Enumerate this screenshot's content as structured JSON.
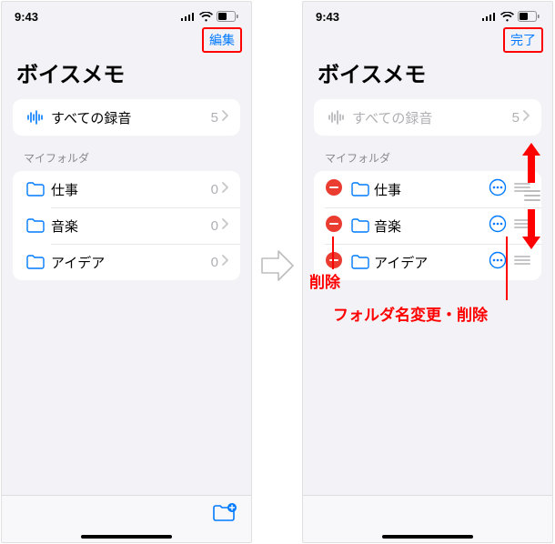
{
  "status": {
    "time": "9:43"
  },
  "left": {
    "top_button": "編集",
    "title": "ボイスメモ",
    "all_recordings": {
      "label": "すべての録音",
      "count": "5"
    },
    "section_header": "マイフォルダ",
    "folders": [
      {
        "name": "仕事",
        "count": "0"
      },
      {
        "name": "音楽",
        "count": "0"
      },
      {
        "name": "アイデア",
        "count": "0"
      }
    ]
  },
  "right": {
    "top_button": "完了",
    "title": "ボイスメモ",
    "all_recordings": {
      "label": "すべての録音",
      "count": "5"
    },
    "section_header": "マイフォルダ",
    "folders": [
      {
        "name": "仕事"
      },
      {
        "name": "音楽"
      },
      {
        "name": "アイデア"
      }
    ]
  },
  "annotations": {
    "delete": "削除",
    "rename_delete": "フォルダ名変更・削除"
  },
  "colors": {
    "accent": "#007aff",
    "highlight": "#ff0000",
    "delete_red": "#ea3c30",
    "bg": "#f2f2f7"
  }
}
